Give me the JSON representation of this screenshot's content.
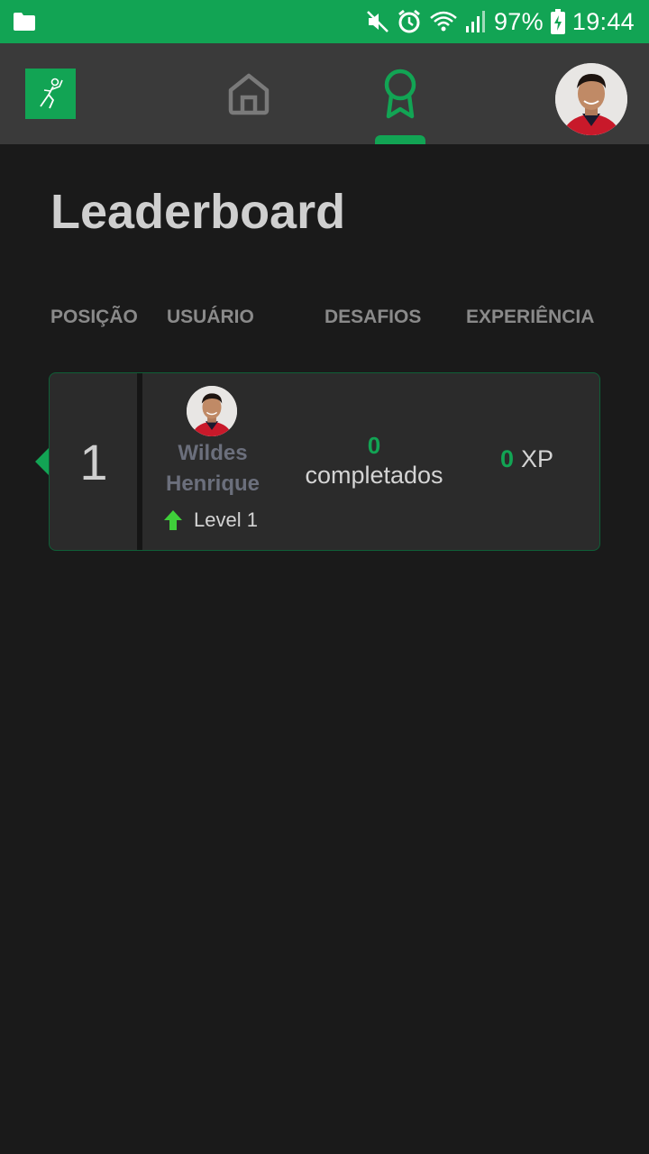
{
  "status_bar": {
    "battery": "97%",
    "time": "19:44",
    "icons": [
      "folder-icon",
      "mute-icon",
      "alarm-icon",
      "wifi-icon",
      "signal-icon",
      "battery-charging-icon"
    ]
  },
  "nav": {
    "logo_icon": "runner-logo-icon",
    "home_icon": "home-icon",
    "leaderboard_icon": "award-icon",
    "active_tab": "leaderboard",
    "accent_color": "#12a454"
  },
  "page": {
    "title": "Leaderboard"
  },
  "table": {
    "headers": {
      "position": "POSIÇÃO",
      "user": "USUÁRIO",
      "challenges": "DESAFIOS",
      "experience": "EXPERIÊNCIA"
    },
    "rows": [
      {
        "position": "1",
        "name_line1": "Wildes",
        "name_line2": "Henrique",
        "level": "Level 1",
        "challenges_count": "0",
        "challenges_label": "completados",
        "xp": "0",
        "xp_unit": "XP"
      }
    ]
  }
}
